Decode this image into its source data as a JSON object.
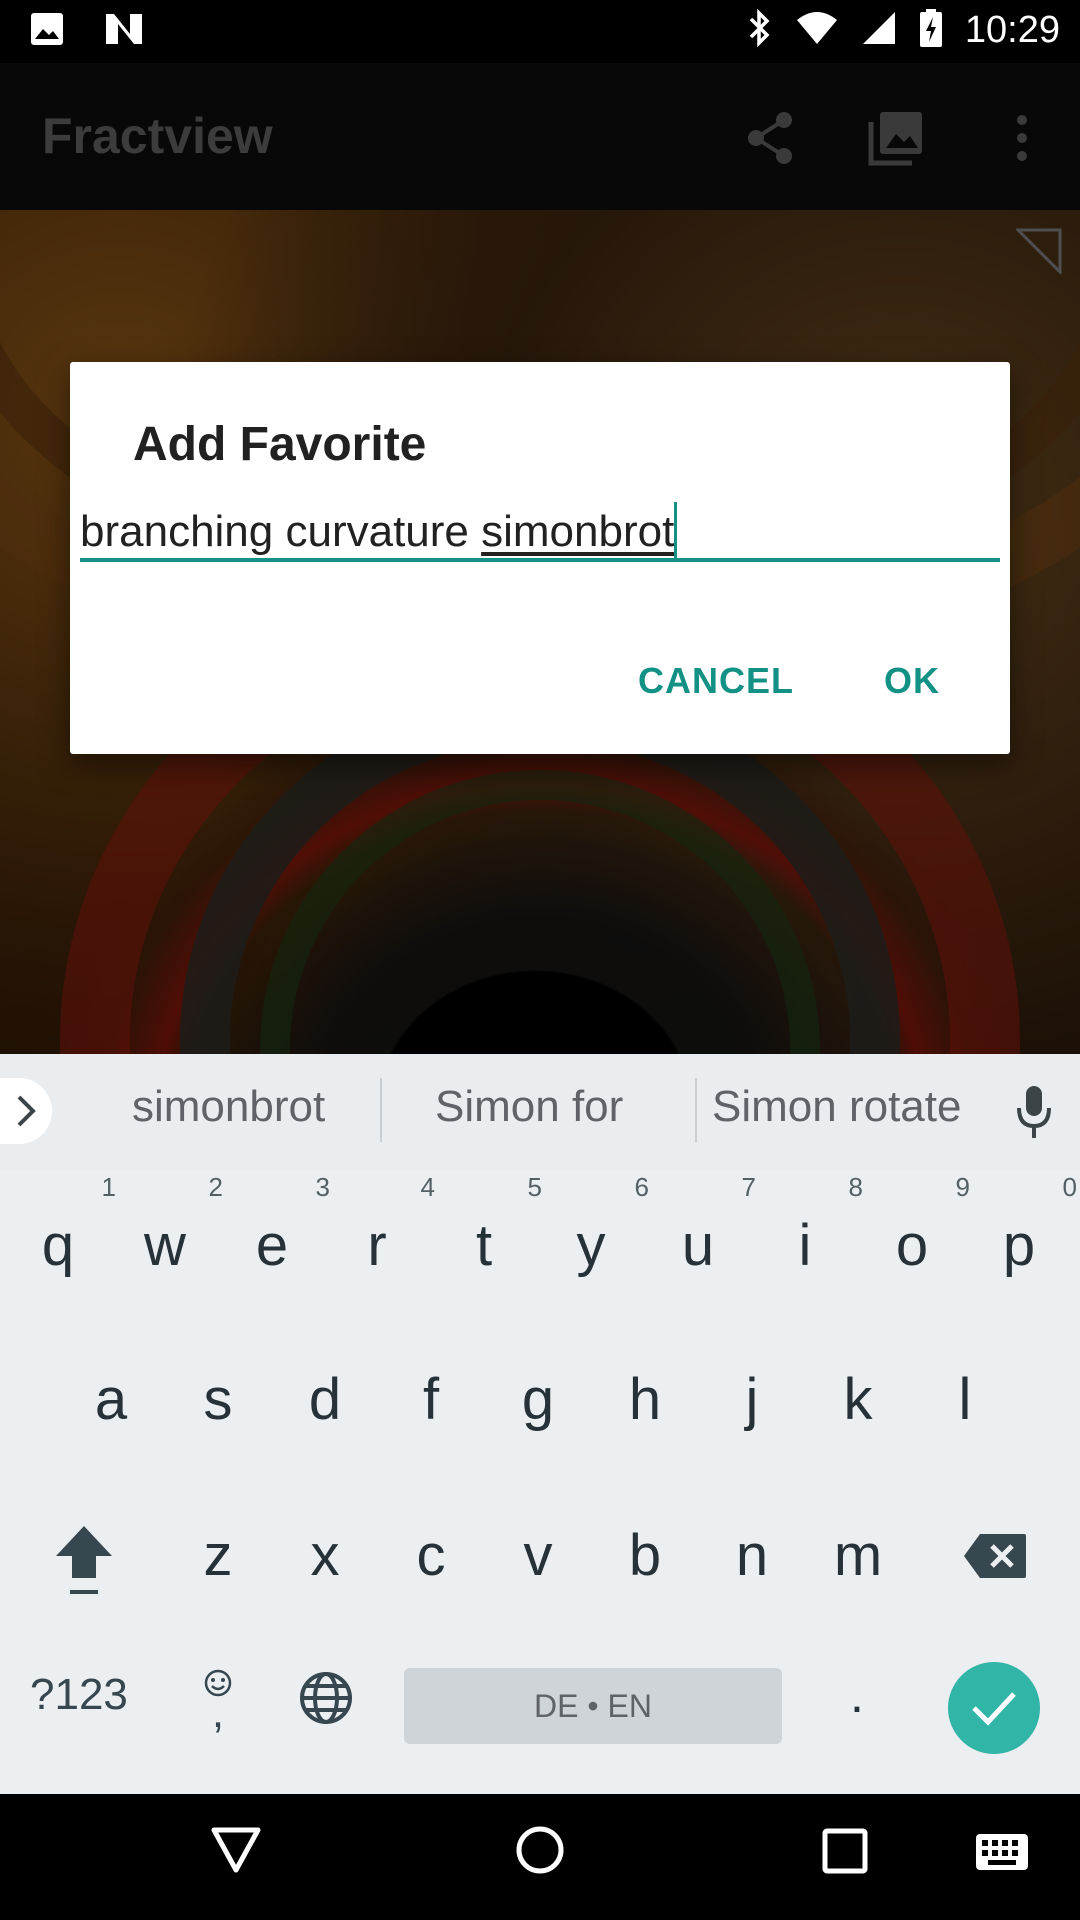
{
  "status_bar": {
    "time": "10:29",
    "icons": [
      "image-notification-icon",
      "n-notification-icon",
      "bluetooth-icon",
      "wifi-icon",
      "cell-signal-icon",
      "battery-charging-icon"
    ]
  },
  "app_bar": {
    "title": "Fractview",
    "actions": [
      "share-icon",
      "gallery-icon",
      "overflow-menu-icon"
    ]
  },
  "dialog": {
    "title": "Add Favorite",
    "input_value_prefix": "branching curvature ",
    "input_value_composing": "simonbrot",
    "cancel_label": "CANCEL",
    "ok_label": "OK"
  },
  "suggestions": {
    "words": [
      "simonbrot",
      "Simon for",
      "Simon rotate"
    ]
  },
  "keyboard": {
    "row1": [
      {
        "key": "q",
        "hint": "1"
      },
      {
        "key": "w",
        "hint": "2"
      },
      {
        "key": "e",
        "hint": "3"
      },
      {
        "key": "r",
        "hint": "4"
      },
      {
        "key": "t",
        "hint": "5"
      },
      {
        "key": "y",
        "hint": "6"
      },
      {
        "key": "u",
        "hint": "7"
      },
      {
        "key": "i",
        "hint": "8"
      },
      {
        "key": "o",
        "hint": "9"
      },
      {
        "key": "p",
        "hint": "0"
      }
    ],
    "row2": [
      "a",
      "s",
      "d",
      "f",
      "g",
      "h",
      "j",
      "k",
      "l"
    ],
    "row3": [
      "z",
      "x",
      "c",
      "v",
      "b",
      "n",
      "m"
    ],
    "symbols_label": "?123",
    "emoji_comma": ",",
    "space_label": "DE • EN",
    "period_label": "."
  },
  "colors": {
    "accent": "#129184",
    "enter_key": "#30b5a6",
    "keyboard_bg": "#eceff1"
  }
}
